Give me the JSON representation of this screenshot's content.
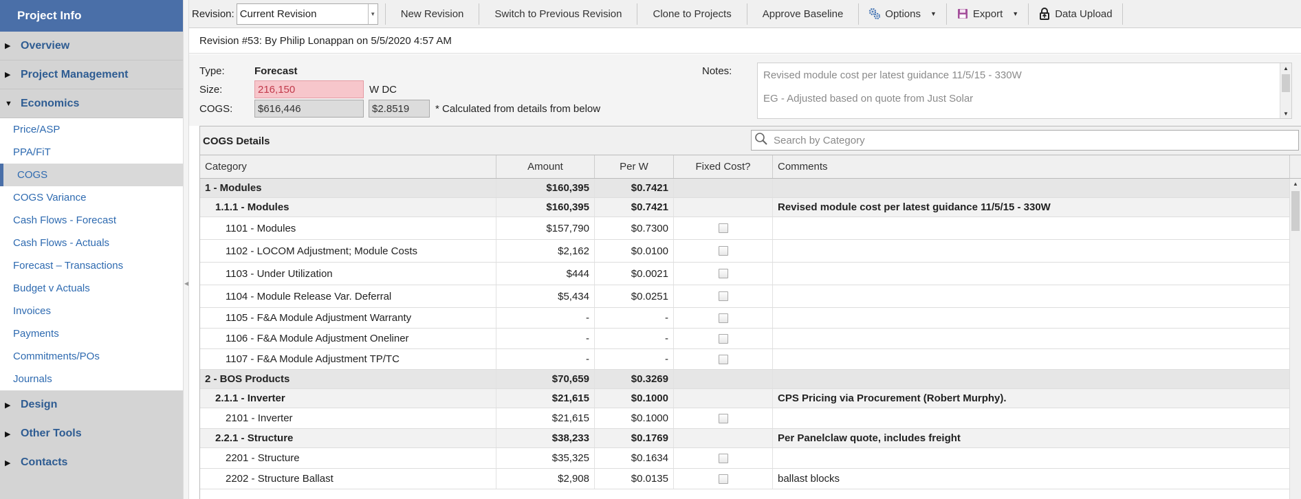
{
  "sidebar": {
    "header": "Project Info",
    "sections_top": [
      {
        "label": "Overview",
        "expanded": false
      },
      {
        "label": "Project Management",
        "expanded": false
      },
      {
        "label": "Economics",
        "expanded": true
      }
    ],
    "items": [
      {
        "label": "Price/ASP",
        "active": false
      },
      {
        "label": "PPA/FiT",
        "active": false
      },
      {
        "label": "COGS",
        "active": true
      },
      {
        "label": "COGS Variance",
        "active": false
      },
      {
        "label": "Cash Flows - Forecast",
        "active": false
      },
      {
        "label": "Cash Flows - Actuals",
        "active": false
      },
      {
        "label": "Forecast – Transactions",
        "active": false
      },
      {
        "label": "Budget v Actuals",
        "active": false
      },
      {
        "label": "Invoices",
        "active": false
      },
      {
        "label": "Payments",
        "active": false
      },
      {
        "label": "Commitments/POs",
        "active": false
      },
      {
        "label": "Journals",
        "active": false
      }
    ],
    "sections_bottom": [
      {
        "label": "Design"
      },
      {
        "label": "Other Tools"
      },
      {
        "label": "Contacts"
      }
    ]
  },
  "toolbar": {
    "revision_label": "Revision:",
    "revision_value": "Current Revision",
    "new_revision": "New Revision",
    "switch_previous": "Switch to Previous Revision",
    "clone": "Clone to Projects",
    "approve": "Approve Baseline",
    "options": "Options",
    "export": "Export",
    "data_upload": "Data Upload"
  },
  "revision_info": "Revision #53: By Philip Lonappan on 5/5/2020 4:57 AM",
  "form": {
    "type_label": "Type:",
    "type_value": "Forecast",
    "size_label": "Size:",
    "size_value": "216,150",
    "size_unit": "W DC",
    "cogs_label": "COGS:",
    "cogs_total": "$616,446",
    "cogs_per_w": "$2.8519",
    "cogs_note": "* Calculated from details from below",
    "notes_label": "Notes:",
    "notes_lines": [
      "Revised module cost per latest guidance 11/5/15 - 330W",
      "EG - Adjusted based on quote from Just Solar"
    ]
  },
  "cogs_details": {
    "title": "COGS Details",
    "search_placeholder": "Search by Category",
    "columns": {
      "category": "Category",
      "amount": "Amount",
      "per_w": "Per W",
      "fixed": "Fixed Cost?",
      "comments": "Comments"
    },
    "rows": [
      {
        "level": "grp",
        "category": "1 - Modules",
        "amount": "$160,395",
        "per_w": "$0.7421",
        "comment": ""
      },
      {
        "level": "sub",
        "category": "1.1.1 - Modules",
        "amount": "$160,395",
        "per_w": "$0.7421",
        "comment": "Revised module cost per latest guidance 11/5/15 - 330W"
      },
      {
        "level": "item",
        "category": "1101 - Modules",
        "amount": "$157,790",
        "per_w": "$0.7300",
        "comment": ""
      },
      {
        "level": "item",
        "category": "1102 - LOCOM Adjustment; Module Costs",
        "amount": "$2,162",
        "per_w": "$0.0100",
        "comment": ""
      },
      {
        "level": "item",
        "category": "1103 - Under Utilization",
        "amount": "$444",
        "per_w": "$0.0021",
        "comment": ""
      },
      {
        "level": "item",
        "category": "1104 - Module Release Var. Deferral",
        "amount": "$5,434",
        "per_w": "$0.0251",
        "comment": ""
      },
      {
        "level": "item",
        "category": "1105 - F&A Module Adjustment Warranty",
        "amount": "-",
        "per_w": "-",
        "comment": ""
      },
      {
        "level": "item",
        "category": "1106 - F&A Module Adjustment Oneliner",
        "amount": "-",
        "per_w": "-",
        "comment": ""
      },
      {
        "level": "item",
        "category": "1107 - F&A Module Adjustment TP/TC",
        "amount": "-",
        "per_w": "-",
        "comment": ""
      },
      {
        "level": "grp",
        "category": "2 - BOS Products",
        "amount": "$70,659",
        "per_w": "$0.3269",
        "comment": ""
      },
      {
        "level": "sub",
        "category": "2.1.1 - Inverter",
        "amount": "$21,615",
        "per_w": "$0.1000",
        "comment": "CPS Pricing via Procurement (Robert Murphy)."
      },
      {
        "level": "item",
        "category": "2101 - Inverter",
        "amount": "$21,615",
        "per_w": "$0.1000",
        "comment": ""
      },
      {
        "level": "sub",
        "category": "2.2.1 - Structure",
        "amount": "$38,233",
        "per_w": "$0.1769",
        "comment": "Per Panelclaw quote, includes freight"
      },
      {
        "level": "item",
        "category": "2201 - Structure",
        "amount": "$35,325",
        "per_w": "$0.1634",
        "comment": ""
      },
      {
        "level": "item",
        "category": "2202 - Structure Ballast",
        "amount": "$2,908",
        "per_w": "$0.0135",
        "comment": "ballast blocks"
      }
    ]
  }
}
